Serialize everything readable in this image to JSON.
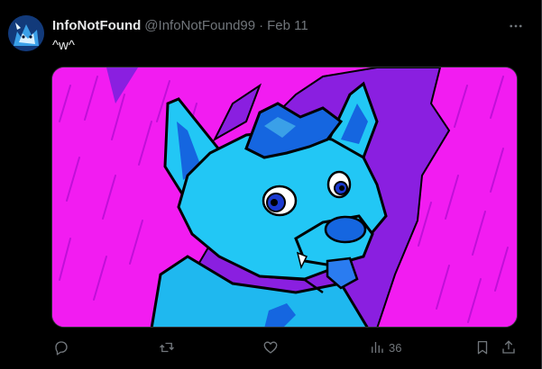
{
  "tweet": {
    "display_name": "InfoNotFound",
    "handle": "@InfoNotFound99",
    "separator": "·",
    "date": "Feb 11",
    "text": "^w^"
  },
  "avatar": {
    "icon": "wolf-avatar"
  },
  "media": {
    "description_icon": "cyan-canine-character-artwork"
  },
  "actions": {
    "reply": {
      "icon": "reply-icon",
      "count": ""
    },
    "retweet": {
      "icon": "retweet-icon",
      "count": ""
    },
    "like": {
      "icon": "heart-icon",
      "count": ""
    },
    "views": {
      "icon": "views-icon",
      "count": "36"
    },
    "bookmark": {
      "icon": "bookmark-icon"
    },
    "share": {
      "icon": "share-icon"
    }
  },
  "colors": {
    "background": "#000000",
    "text_primary": "#e7e9ea",
    "text_secondary": "#71767b",
    "art_magenta": "#f21cf1",
    "art_purple": "#8a1fe0",
    "art_cyan": "#22c7f5"
  }
}
